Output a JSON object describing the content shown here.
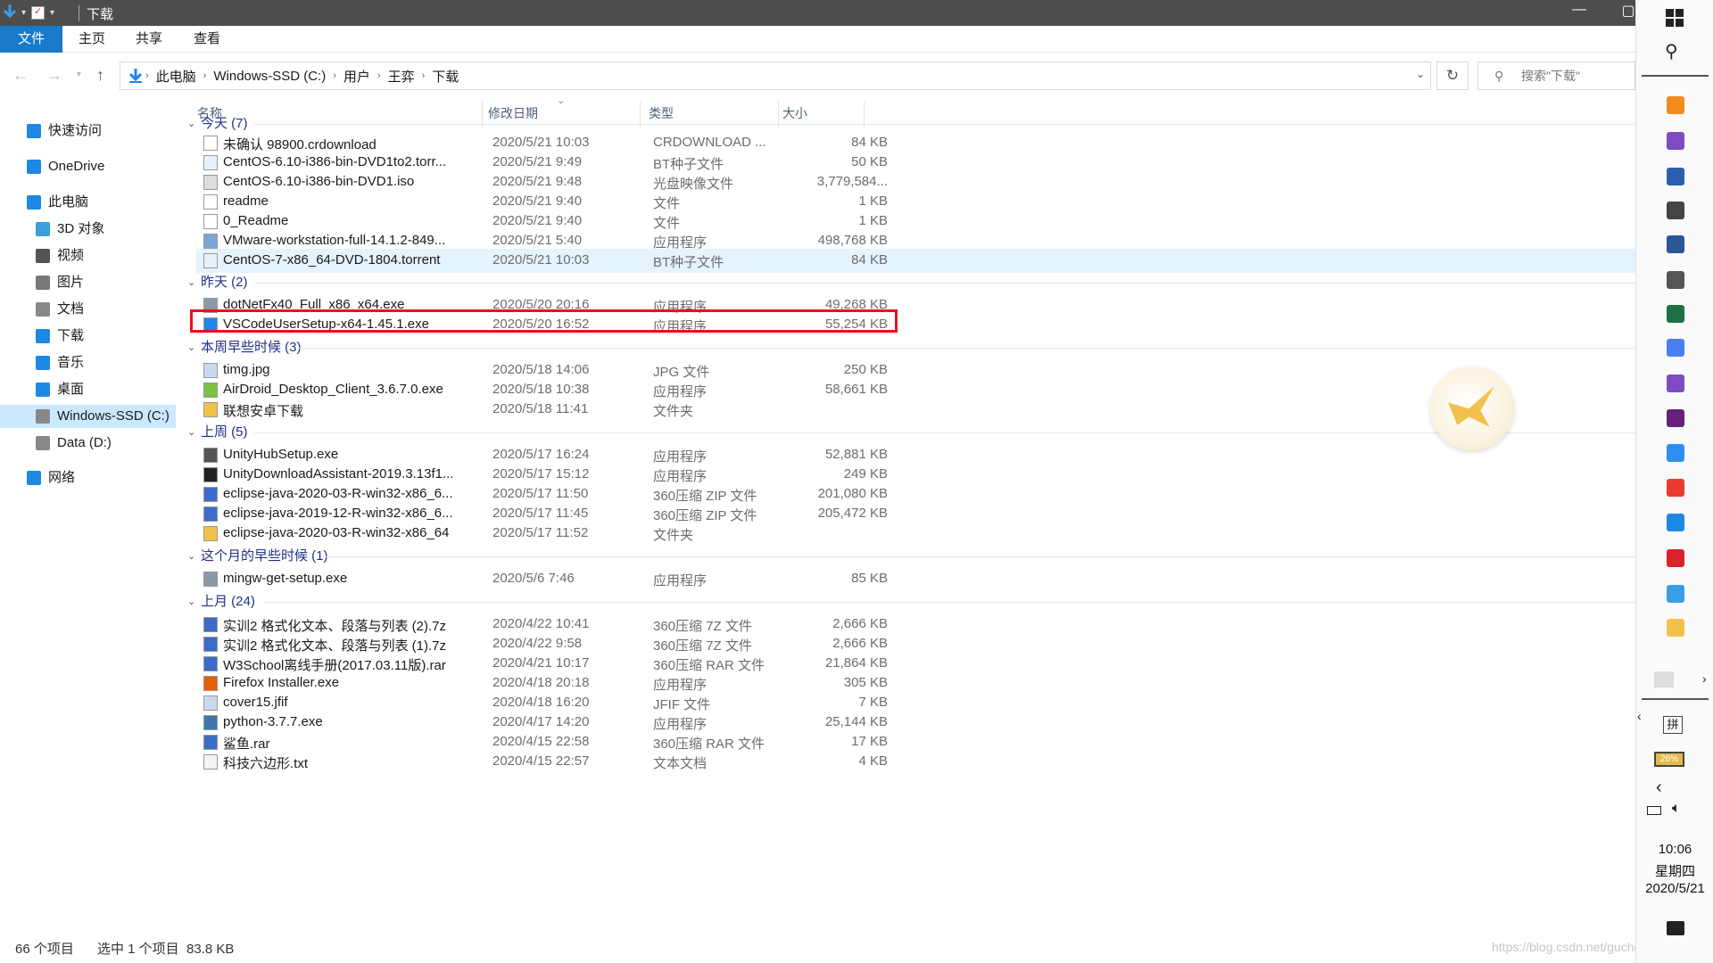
{
  "window": {
    "title": "下载",
    "controls": {
      "minimize": "—",
      "maximize": "▢"
    }
  },
  "ribbon": {
    "tabs": [
      {
        "label": "文件"
      },
      {
        "label": "主页"
      },
      {
        "label": "共享"
      },
      {
        "label": "查看"
      }
    ]
  },
  "address": {
    "crumbs": [
      "此电脑",
      "Windows-SSD (C:)",
      "用户",
      "王弈",
      "下载"
    ],
    "search_placeholder": "搜索\"下载\""
  },
  "nav": {
    "items": [
      {
        "label": "快速访问",
        "icon": "star-icon",
        "color": "#1e88e5",
        "sel": false
      },
      {
        "label": "OneDrive",
        "icon": "cloud-icon",
        "color": "#1e88e5",
        "sel": false
      },
      {
        "label": "此电脑",
        "icon": "computer-icon",
        "color": "#1e88e5",
        "sel": false
      },
      {
        "label": "3D 对象",
        "icon": "cube-icon",
        "color": "#39a0da",
        "sel": false
      },
      {
        "label": "视频",
        "icon": "film-icon",
        "color": "#555555",
        "sel": false
      },
      {
        "label": "图片",
        "icon": "picture-icon",
        "color": "#777777",
        "sel": false
      },
      {
        "label": "文档",
        "icon": "document-icon",
        "color": "#888888",
        "sel": false
      },
      {
        "label": "下载",
        "icon": "download-icon",
        "color": "#1e88e5",
        "sel": false
      },
      {
        "label": "音乐",
        "icon": "music-icon",
        "color": "#1e88e5",
        "sel": false
      },
      {
        "label": "桌面",
        "icon": "desktop-icon",
        "color": "#1e88e5",
        "sel": false
      },
      {
        "label": "Windows-SSD (C:)",
        "icon": "drive-icon",
        "color": "#888888",
        "sel": true
      },
      {
        "label": "Data (D:)",
        "icon": "drive-icon",
        "color": "#888888",
        "sel": false
      },
      {
        "label": "网络",
        "icon": "network-icon",
        "color": "#1e88e5",
        "sel": false
      }
    ]
  },
  "columns": {
    "name": "名称",
    "date": "修改日期",
    "type": "类型",
    "size": "大小"
  },
  "groups": [
    {
      "title": "今天 (7)",
      "files": [
        {
          "name": "未确认 98900.crdownload",
          "date": "2020/5/21 10:03",
          "type": "CRDOWNLOAD ...",
          "size": "84 KB",
          "icon": "blank-file-icon"
        },
        {
          "name": "CentOS-6.10-i386-bin-DVD1to2.torr...",
          "date": "2020/5/21 9:49",
          "type": "BT种子文件",
          "size": "50 KB",
          "icon": "torrent-file-icon"
        },
        {
          "name": "CentOS-6.10-i386-bin-DVD1.iso",
          "date": "2020/5/21 9:48",
          "type": "光盘映像文件",
          "size": "3,779,584...",
          "icon": "disc-image-icon"
        },
        {
          "name": "readme",
          "date": "2020/5/21 9:40",
          "type": "文件",
          "size": "1 KB",
          "icon": "blank-file-icon"
        },
        {
          "name": "0_Readme",
          "date": "2020/5/21 9:40",
          "type": "文件",
          "size": "1 KB",
          "icon": "blank-file-icon"
        },
        {
          "name": "VMware-workstation-full-14.1.2-849...",
          "date": "2020/5/21 5:40",
          "type": "应用程序",
          "size": "498,768 KB",
          "icon": "vmware-icon"
        },
        {
          "name": "CentOS-7-x86_64-DVD-1804.torrent",
          "date": "2020/5/21 10:03",
          "type": "BT种子文件",
          "size": "84 KB",
          "icon": "torrent-file-icon"
        }
      ]
    },
    {
      "title": "昨天 (2)",
      "files": [
        {
          "name": "dotNetFx40_Full_x86_x64.exe",
          "date": "2020/5/20 20:16",
          "type": "应用程序",
          "size": "49,268 KB",
          "icon": "installer-icon"
        },
        {
          "name": "VSCodeUserSetup-x64-1.45.1.exe",
          "date": "2020/5/20 16:52",
          "type": "应用程序",
          "size": "55,254 KB",
          "icon": "vscode-icon"
        }
      ]
    },
    {
      "title": "本周早些时候 (3)",
      "files": [
        {
          "name": "timg.jpg",
          "date": "2020/5/18 14:06",
          "type": "JPG 文件",
          "size": "250 KB",
          "icon": "image-file-icon"
        },
        {
          "name": "AirDroid_Desktop_Client_3.6.7.0.exe",
          "date": "2020/5/18 10:38",
          "type": "应用程序",
          "size": "58,661 KB",
          "icon": "airdroid-icon"
        },
        {
          "name": "联想安卓下载",
          "date": "2020/5/18 11:41",
          "type": "文件夹",
          "size": "",
          "icon": "folder-icon"
        }
      ]
    },
    {
      "title": "上周 (5)",
      "files": [
        {
          "name": "UnityHubSetup.exe",
          "date": "2020/5/17 16:24",
          "type": "应用程序",
          "size": "52,881 KB",
          "icon": "unity-icon"
        },
        {
          "name": "UnityDownloadAssistant-2019.3.13f1...",
          "date": "2020/5/17 15:12",
          "type": "应用程序",
          "size": "249 KB",
          "icon": "unity-dark-icon"
        },
        {
          "name": "eclipse-java-2020-03-R-win32-x86_6...",
          "date": "2020/5/17 11:50",
          "type": "360压缩 ZIP 文件",
          "size": "201,080 KB",
          "icon": "archive-icon"
        },
        {
          "name": "eclipse-java-2019-12-R-win32-x86_6...",
          "date": "2020/5/17 11:45",
          "type": "360压缩 ZIP 文件",
          "size": "205,472 KB",
          "icon": "archive-icon"
        },
        {
          "name": "eclipse-java-2020-03-R-win32-x86_64",
          "date": "2020/5/17 11:52",
          "type": "文件夹",
          "size": "",
          "icon": "folder-icon"
        }
      ]
    },
    {
      "title": "这个月的早些时候 (1)",
      "files": [
        {
          "name": "mingw-get-setup.exe",
          "date": "2020/5/6 7:46",
          "type": "应用程序",
          "size": "85 KB",
          "icon": "installer-icon"
        }
      ]
    },
    {
      "title": "上月 (24)",
      "files": [
        {
          "name": "实训2 格式化文本、段落与列表 (2).7z",
          "date": "2020/4/22 10:41",
          "type": "360压缩 7Z 文件",
          "size": "2,666 KB",
          "icon": "archive-icon"
        },
        {
          "name": "实训2 格式化文本、段落与列表 (1).7z",
          "date": "2020/4/22 9:58",
          "type": "360压缩 7Z 文件",
          "size": "2,666 KB",
          "icon": "archive-icon"
        },
        {
          "name": "W3School离线手册(2017.03.11版).rar",
          "date": "2020/4/21 10:17",
          "type": "360压缩 RAR 文件",
          "size": "21,864 KB",
          "icon": "archive-icon"
        },
        {
          "name": "Firefox Installer.exe",
          "date": "2020/4/18 20:18",
          "type": "应用程序",
          "size": "305 KB",
          "icon": "firefox-icon"
        },
        {
          "name": "cover15.jfif",
          "date": "2020/4/18 16:20",
          "type": "JFIF 文件",
          "size": "7 KB",
          "icon": "image-file-icon"
        },
        {
          "name": "python-3.7.7.exe",
          "date": "2020/4/17 14:20",
          "type": "应用程序",
          "size": "25,144 KB",
          "icon": "python-icon"
        },
        {
          "name": "鲨鱼.rar",
          "date": "2020/4/15 22:58",
          "type": "360压缩 RAR 文件",
          "size": "17 KB",
          "icon": "archive-icon"
        },
        {
          "name": "科技六边形.txt",
          "date": "2020/4/15 22:57",
          "type": "文本文档",
          "size": "4 KB",
          "icon": "text-file-icon"
        }
      ]
    }
  ],
  "status": {
    "count": "66 个项目",
    "selected": "选中 1 个项目  83.8 KB"
  },
  "watermark": "https://blog.csdn.net/guchengyixin",
  "taskbar": {
    "ime": "拼",
    "battery": "26%",
    "time": "10:06",
    "weekday": "星期四",
    "date": "2020/5/21",
    "app_icons": [
      {
        "name": "sublime-icon",
        "color": "#f28b1e"
      },
      {
        "name": "visual-studio-icon",
        "color": "#7d4cc2"
      },
      {
        "name": "cmd-icon",
        "color": "#2a5fb0"
      },
      {
        "name": "unity-icon",
        "color": "#444444"
      },
      {
        "name": "word-icon",
        "color": "#2b5797"
      },
      {
        "name": "calculator-icon",
        "color": "#555555"
      },
      {
        "name": "excel-icon",
        "color": "#1e7145"
      },
      {
        "name": "feishu-icon",
        "color": "#4a7ff0"
      },
      {
        "name": "visual-studio-2-icon",
        "color": "#7d4cc2"
      },
      {
        "name": "visual-studio-3-icon",
        "color": "#68217a"
      },
      {
        "name": "baidu-netdisk-icon",
        "color": "#2f8ef5"
      },
      {
        "name": "youdao-icon",
        "color": "#e83b2e"
      },
      {
        "name": "feiq-icon",
        "color": "#1e88e5"
      },
      {
        "name": "netease-music-icon",
        "color": "#d8232a"
      },
      {
        "name": "control-panel-icon",
        "color": "#3b9de8"
      },
      {
        "name": "file-explorer-icon",
        "color": "#f2c14b"
      }
    ]
  }
}
